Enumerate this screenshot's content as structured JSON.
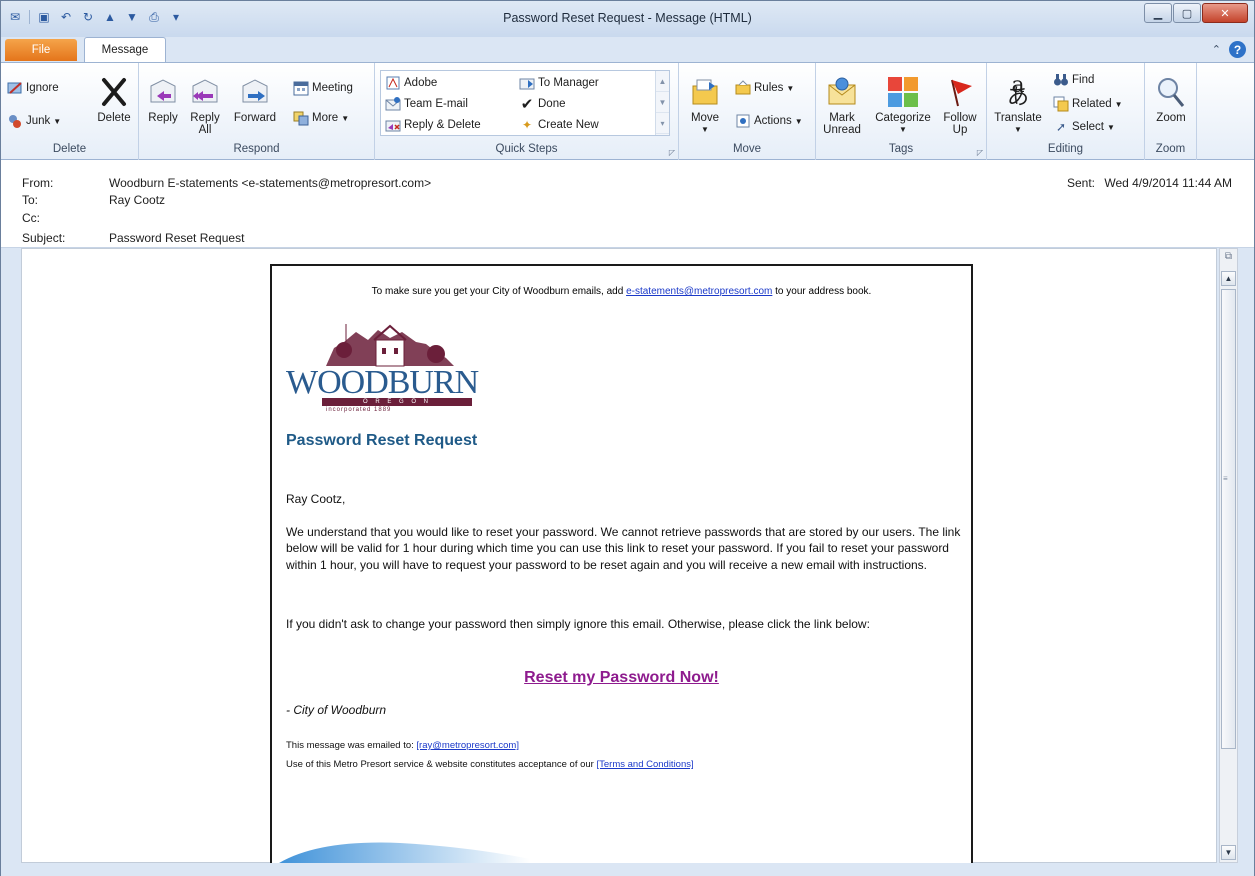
{
  "window": {
    "title": "Password Reset Request  -  Message (HTML)"
  },
  "tabs": {
    "file": "File",
    "message": "Message"
  },
  "ribbon": {
    "delete_group": {
      "label": "Delete",
      "ignore": "Ignore",
      "junk": "Junk",
      "delete": "Delete"
    },
    "respond_group": {
      "label": "Respond",
      "reply": "Reply",
      "reply_all_line1": "Reply",
      "reply_all_line2": "All",
      "forward": "Forward",
      "meeting": "Meeting",
      "more": "More"
    },
    "quicksteps_group": {
      "label": "Quick Steps",
      "items": [
        "Adobe",
        "Team E-mail",
        "Reply & Delete",
        "To Manager",
        "Done",
        "Create New"
      ]
    },
    "move_group": {
      "label": "Move",
      "move": "Move",
      "rules": "Rules",
      "actions": "Actions"
    },
    "tags_group": {
      "label": "Tags",
      "mark_unread_line1": "Mark",
      "mark_unread_line2": "Unread",
      "categorize": "Categorize",
      "follow_up_line1": "Follow",
      "follow_up_line2": "Up"
    },
    "editing_group": {
      "label": "Editing",
      "translate": "Translate",
      "find": "Find",
      "related": "Related",
      "select": "Select"
    },
    "zoom_group": {
      "label": "Zoom",
      "zoom": "Zoom"
    }
  },
  "header": {
    "from_label": "From:",
    "from_value": "Woodburn E-statements <e-statements@metropresort.com>",
    "to_label": "To:",
    "to_value": "Ray Cootz",
    "cc_label": "Cc:",
    "cc_value": "",
    "subject_label": "Subject:",
    "subject_value": "Password Reset Request",
    "sent_label": "Sent:",
    "sent_value": "Wed 4/9/2014 11:44 AM"
  },
  "email": {
    "top_prefix": "To make sure you get your City of Woodburn emails, add ",
    "top_link": "e-statements@metropresort.com",
    "top_suffix": " to your address book.",
    "logo_text": "WOODBURN",
    "logo_sub": "O R E G O N",
    "logo_tag": "incorporated 1889",
    "title": "Password Reset Request",
    "greeting": "Ray Cootz,",
    "para1": "We understand that you would like to reset your password. We cannot retrieve passwords that are stored by our users. The link below will be valid for 1 hour during which time you can use this link to reset your password. If you fail to reset your password within 1 hour, you will have to request your password to be reset again and you will receive a new email with instructions.",
    "para2": "If you didn't ask to change your password then simply ignore this email. Otherwise, please click the link below:",
    "reset_link": "Reset my Password Now!",
    "signature": "- City of Woodburn",
    "emailed_prefix": "This message was emailed to: ",
    "emailed_link": "[ray@metropresort.com]",
    "terms_prefix": "Use of this Metro Presort service & website constitutes acceptance of our ",
    "terms_link": "[Terms and Conditions]"
  },
  "colors": {
    "title_blue": "#1f5a87",
    "link_blue": "#1b39c9",
    "reset_purple": "#8e1b8e",
    "logo_maroon": "#6b1f3a",
    "logo_blue": "#2a5b8f"
  }
}
